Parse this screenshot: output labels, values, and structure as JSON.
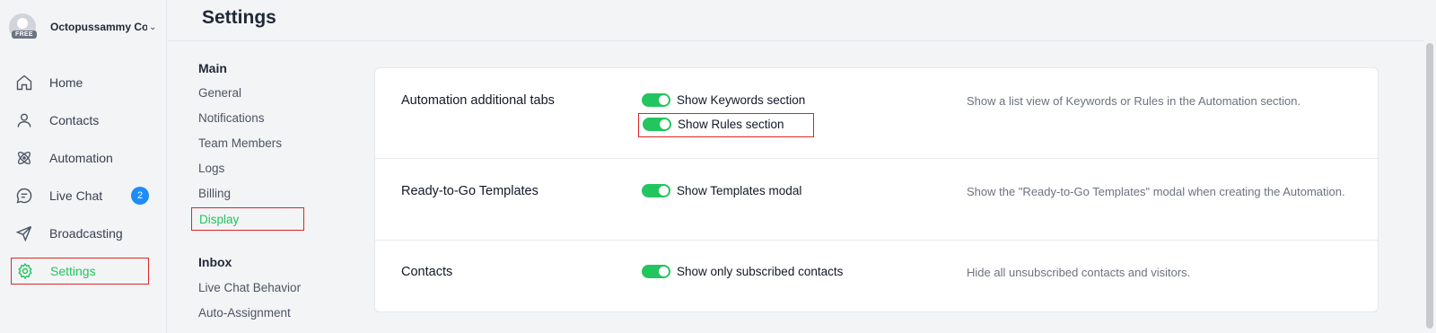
{
  "account": {
    "name": "Octopussammy Cor",
    "plan_badge": "FREE"
  },
  "nav": [
    {
      "label": "Home",
      "icon": "home-icon"
    },
    {
      "label": "Contacts",
      "icon": "user-icon"
    },
    {
      "label": "Automation",
      "icon": "atom-icon"
    },
    {
      "label": "Live Chat",
      "icon": "chat-icon",
      "badge": "2"
    },
    {
      "label": "Broadcasting",
      "icon": "send-icon"
    },
    {
      "label": "Settings",
      "icon": "gear-icon",
      "active": true
    }
  ],
  "page": {
    "title": "Settings"
  },
  "settings_nav": {
    "groups": [
      {
        "title": "Main",
        "items": [
          "General",
          "Notifications",
          "Team Members",
          "Logs",
          "Billing",
          "Display"
        ]
      },
      {
        "title": "Inbox",
        "items": [
          "Live Chat Behavior",
          "Auto-Assignment"
        ]
      }
    ],
    "active": "Display"
  },
  "rows": [
    {
      "title": "Automation additional tabs",
      "toggles": [
        {
          "label": "Show Keywords section",
          "on": true
        },
        {
          "label": "Show Rules section",
          "on": true
        }
      ],
      "description": "Show a list view of Keywords or Rules in the Automation section."
    },
    {
      "title": "Ready-to-Go Templates",
      "toggles": [
        {
          "label": "Show Templates modal",
          "on": true
        }
      ],
      "description": "Show the \"Ready-to-Go Templates\" modal when creating the Automation."
    },
    {
      "title": "Contacts",
      "toggles": [
        {
          "label": "Show only subscribed contacts",
          "on": true
        }
      ],
      "description": "Hide all unsubscribed contacts and visitors."
    }
  ],
  "colors": {
    "accent": "#22c55e",
    "highlight": "#dc2626",
    "badge": "#1d8cf8"
  }
}
